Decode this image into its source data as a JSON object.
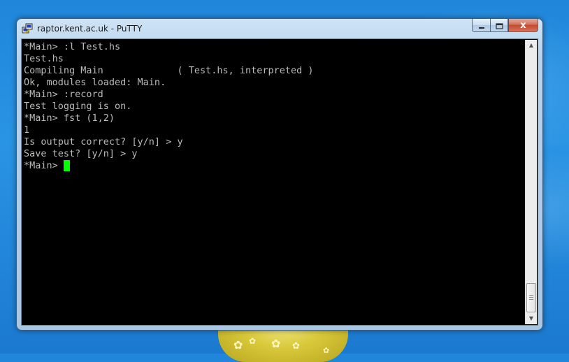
{
  "window": {
    "title": "raptor.kent.ac.uk - PuTTY",
    "close_glyph": "x"
  },
  "icons": {
    "app": "putty-icon",
    "minimize": "minimize-icon",
    "maximize": "maximize-icon",
    "close": "close-icon",
    "scroll_up": "scroll-up-arrow-icon",
    "scroll_down": "scroll-down-arrow-icon"
  },
  "terminal": {
    "lines": [
      "*Main> :l Test.hs",
      "Test.hs",
      "Compiling Main             ( Test.hs, interpreted )",
      "Ok, modules loaded: Main.",
      "*Main> :record",
      "Test logging is on.",
      "*Main> fst (1,2)",
      "1",
      "Is output correct? [y/n] > y",
      "Save test? [y/n] > y",
      "*Main> "
    ],
    "text_color": "#bbbbbb",
    "background": "#000000",
    "cursor_color": "#00ff00"
  },
  "scrollbar": {
    "position_fraction": 1.0
  },
  "colors": {
    "desktop": "#1f86d9",
    "window_frame": "#b9d3ec",
    "close_button": "#c14a31"
  }
}
